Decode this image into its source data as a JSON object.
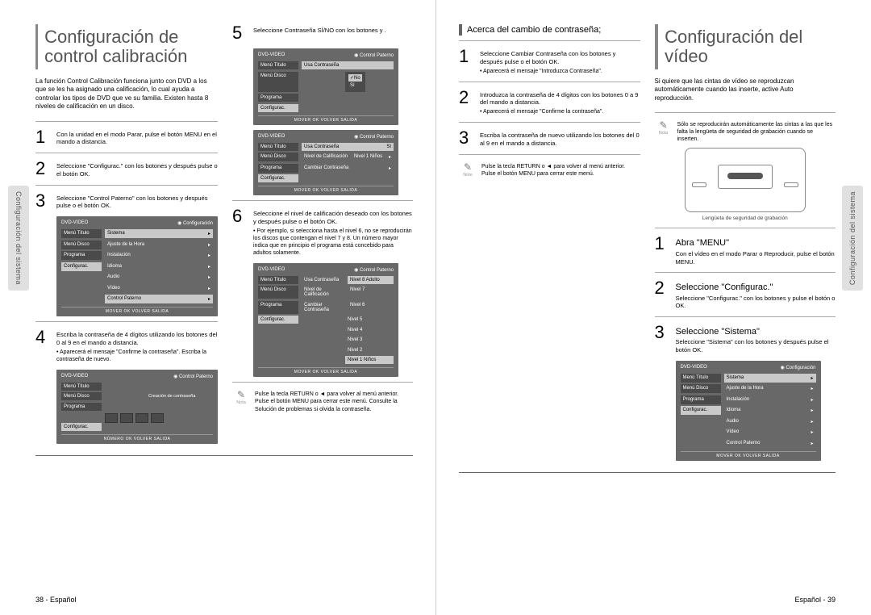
{
  "page_left": {
    "tab": "Configuración del sistema",
    "title": "Configuración de control calibración",
    "intro": "La función Control Calibración funciona junto con DVD a los que se les ha asignado una calificación, lo cual ayuda a controlar los tipos de DVD que ve su familia. Existen hasta 8 niveles de calificación en un disco.",
    "steps_a": {
      "s1": "Con la unidad en el modo Parar, pulse el botón MENU en el mando a distancia.",
      "s2": "Seleccione \"Configurac.\" con los botones y después pulse o el botón OK.",
      "s3": "Seleccione \"Control Paterno\" con los botones y después pulse o el botón OK.",
      "s4": "Escriba la contraseña de 4 dígitos utilizando los botones del 0 al 9 en el mando a distancia.",
      "s4sub": "• Aparecerá el mensaje \"Confirme la contraseña\". Escriba la contraseña de nuevo."
    },
    "steps_b": {
      "s5": "Seleccione Contraseña SÍ/NO con los botones y .",
      "s6": "Seleccione el nivel de calificación deseado con los botones y después pulse o el botón OK.",
      "s6sub": "• Por ejemplo, si selecciona hasta el nivel 6, no se reproducirán los discos que contengan el nivel 7 y 8. Un número mayor indica que en principio el programa está concebido para adultos solamente."
    },
    "note": "Pulse la tecla RETURN o ◄ para volver al menú anterior. Pulse el botón MENU para cerrar este menú.\nConsulte la Solución de problemas si olvida la contraseña.",
    "note_label": "Nota",
    "ss1": {
      "device": "DVD-VIDEO",
      "head": "Configuración",
      "m1": "Menú Título",
      "m2": "Menú Disco",
      "m3": "Programa",
      "m4": "Configurac.",
      "i1": "Sistema",
      "i2": "Ajuste de la Hora",
      "i3": "Instalación",
      "i4": "Idioma",
      "i5": "Audio",
      "i6": "Vídeo",
      "i7": "Control Paterno",
      "foot": "MOVER  OK  VOLVER  SALIDA"
    },
    "ss2": {
      "head": "Control Paterno",
      "label": "Creación de contraseña",
      "foot": "NÚMERO  OK  VOLVER  SALIDA"
    },
    "ss3": {
      "head": "Control Paterno",
      "item": "Usa Contraseña",
      "opt1": "No",
      "opt2": "Sí"
    },
    "ss4": {
      "head": "Control Paterno",
      "i1": "Usa Contraseña",
      "v1": "Sí",
      "i2": "Nivel de Calificación",
      "v2": "Nivel 1 Niños",
      "i3": "Cambiar Contraseña"
    },
    "ss5": {
      "head": "Control Paterno",
      "i1": "Usa Contraseña",
      "i2": "Nivel de Calificación",
      "i3": "Cambiar Contraseña",
      "l1": "Nivel 8 Adulto",
      "l2": "Nivel 7",
      "l3": "Nivel 6",
      "l4": "Nivel 5",
      "l5": "Nivel 4",
      "l6": "Nivel 3",
      "l7": "Nivel 2",
      "l8": "Nivel 1 Niños"
    },
    "footer": "38 - Español"
  },
  "page_right": {
    "tab": "Configuración del sistema",
    "sectA": "Acerca del cambio de contraseña;",
    "stepsA": {
      "s1": "Seleccione Cambiar Contraseña con los botones y después pulse o el botón OK.",
      "s1sub": "• Aparecerá el mensaje \"Introduzca Contraseña\".",
      "s2": "Introduzca la contraseña de 4 dígitos con los botones 0 a 9 del mando a distancia.",
      "s2sub": "• Aparecerá el mensaje \"Confirme la contraseña\".",
      "s3": "Escriba la contraseña de nuevo utilizando los botones del 0 al 9 en el mando a distancia."
    },
    "noteA": "Pulse la tecla RETURN o ◄ para volver al menú anterior. Pulse el botón MENU para cerrar este menú.",
    "noteA_label": "Note",
    "title": "Configuración del vídeo",
    "intro": "Si quiere que las cintas de vídeo se reproduzcan automáticamente cuando las inserte, active Auto reproducción.",
    "noteB": "Sólo se reproducirán automáticamente las cintas a las que les falta la lengüeta de seguridad de grabación cuando se inserten.",
    "noteB_label": "Nota",
    "vhs_caption": "Lengüeta de seguridad de grabación",
    "stepsB": {
      "s1t": "Abra \"MENU\"",
      "s1": "Con el vídeo en el modo Parar o Reproducir, pulse el botón MENU.",
      "s2t": "Seleccione \"Configurac.\"",
      "s2": "Seleccione \"Configurac.\" con los botones y pulse el botón o OK.",
      "s3t": "Seleccione \"Sistema\"",
      "s3": "Seleccione \"Sistema\" con los botones y después pulse el botón OK."
    },
    "ss6": {
      "device": "DVD-VIDEO",
      "head": "Configuración",
      "m1": "Menú Título",
      "m2": "Menú Disco",
      "m3": "Programa",
      "m4": "Configurac.",
      "i1": "Sistema",
      "i2": "Ajuste de la Hora",
      "i3": "Instalación",
      "i4": "Idioma",
      "i5": "Audio",
      "i6": "Vídeo",
      "i7": "Control Paterno",
      "foot": "MOVER  OK  VOLVER  SALIDA"
    },
    "footer": "Español - 39"
  }
}
